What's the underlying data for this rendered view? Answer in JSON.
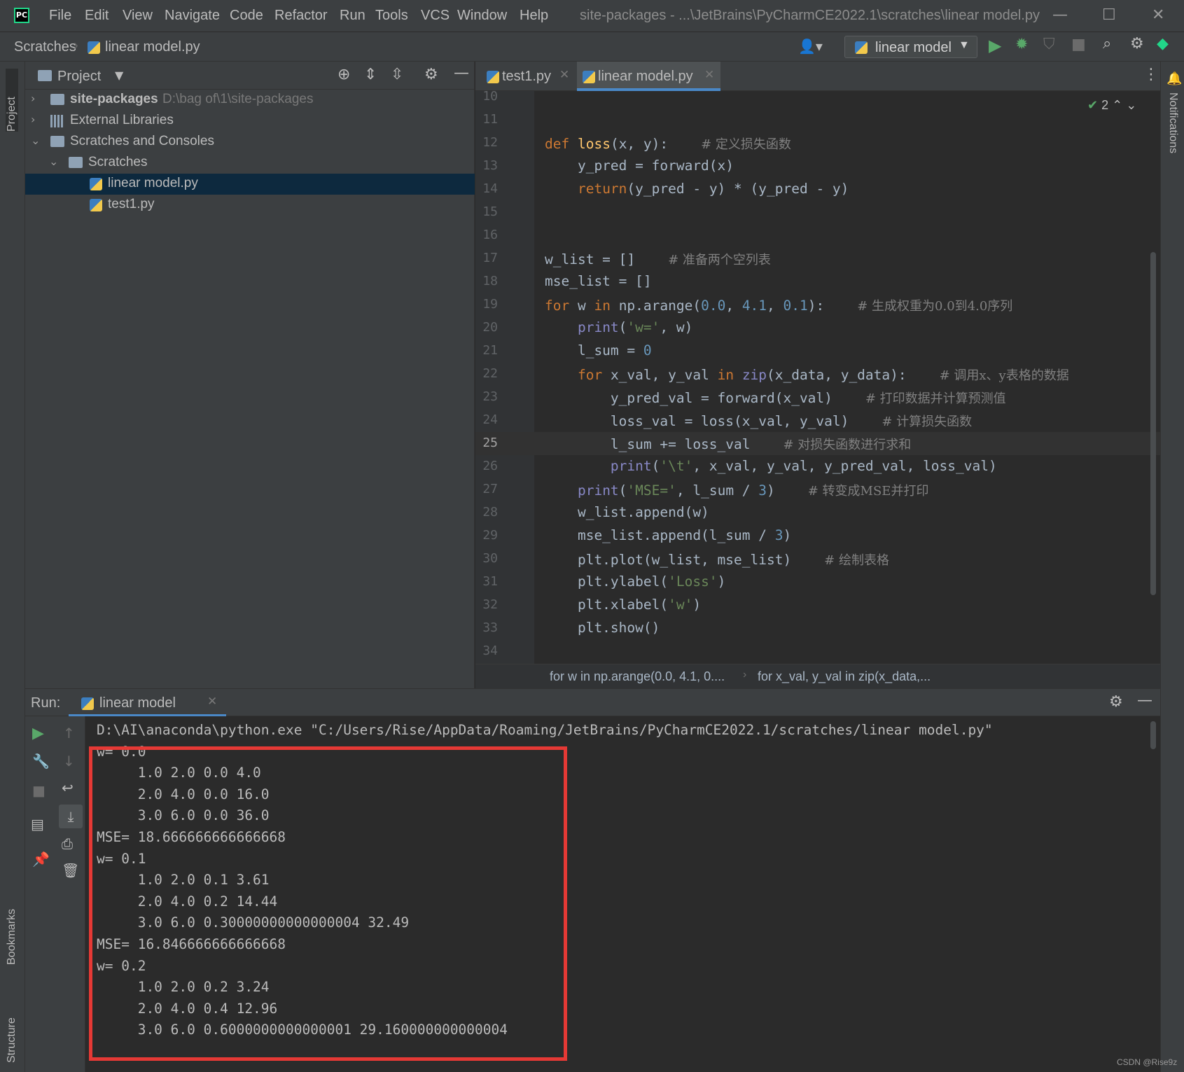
{
  "app": {
    "logo_text": "PC",
    "window_title": "site-packages - ...\\JetBrains\\PyCharmCE2022.1\\scratches\\linear model.py"
  },
  "menu": [
    "File",
    "Edit",
    "View",
    "Navigate",
    "Code",
    "Refactor",
    "Run",
    "Tools",
    "VCS",
    "Window",
    "Help"
  ],
  "breadcrumb": {
    "root": "Scratches",
    "file": "linear model.py"
  },
  "run_config": {
    "label": "linear model"
  },
  "sidebar_tabs": {
    "left_top": "Project",
    "left_bottom_1": "Bookmarks",
    "left_bottom_2": "Structure",
    "right": "Notifications"
  },
  "project": {
    "title": "Project",
    "tree": [
      {
        "label": "site-packages",
        "hint": "D:\\bag of\\1\\site-packages",
        "expanded": false
      },
      {
        "label": "External Libraries",
        "expanded": false
      },
      {
        "label": "Scratches and Consoles",
        "expanded": true
      },
      {
        "label": "Scratches",
        "expanded": true
      },
      {
        "label": "linear model.py",
        "selected": true
      },
      {
        "label": "test1.py"
      }
    ]
  },
  "editor": {
    "tabs": [
      {
        "label": "test1.py",
        "active": false
      },
      {
        "label": "linear model.py",
        "active": true
      }
    ],
    "inspection_count": "2",
    "current_line": 25,
    "lines": [
      {
        "n": "10",
        "code": ""
      },
      {
        "n": "11",
        "code": ""
      },
      {
        "n": "12",
        "code": "def loss(x, y):",
        "comment": "# 定义损失函数"
      },
      {
        "n": "13",
        "code": "    y_pred = forward(x)"
      },
      {
        "n": "14",
        "code": "    return(y_pred - y) * (y_pred - y)"
      },
      {
        "n": "15",
        "code": ""
      },
      {
        "n": "16",
        "code": ""
      },
      {
        "n": "17",
        "code": "w_list = []",
        "comment": "# 准备两个空列表"
      },
      {
        "n": "18",
        "code": "mse_list = []"
      },
      {
        "n": "19",
        "code": "for w in np.arange(0.0, 4.1, 0.1):",
        "comment": "# 生成权重为0.0到4.0序列"
      },
      {
        "n": "20",
        "code": "    print('w=', w)"
      },
      {
        "n": "21",
        "code": "    l_sum = 0"
      },
      {
        "n": "22",
        "code": "    for x_val, y_val in zip(x_data, y_data):",
        "comment": "# 调用x、y表格的数据"
      },
      {
        "n": "23",
        "code": "        y_pred_val = forward(x_val)",
        "comment": "# 打印数据并计算预测值"
      },
      {
        "n": "24",
        "code": "        loss_val = loss(x_val, y_val)",
        "comment": "# 计算损失函数"
      },
      {
        "n": "25",
        "code": "        l_sum += loss_val",
        "comment": "# 对损失函数进行求和"
      },
      {
        "n": "26",
        "code": "        print('\\t', x_val, y_val, y_pred_val, loss_val)"
      },
      {
        "n": "27",
        "code": "    print('MSE=', l_sum / 3)",
        "comment": "# 转变成MSE并打印"
      },
      {
        "n": "28",
        "code": "    w_list.append(w)"
      },
      {
        "n": "29",
        "code": "    mse_list.append(l_sum / 3)"
      },
      {
        "n": "30",
        "code": "    plt.plot(w_list, mse_list)",
        "comment": "# 绘制表格"
      },
      {
        "n": "31",
        "code": "    plt.ylabel('Loss')"
      },
      {
        "n": "32",
        "code": "    plt.xlabel('w')"
      },
      {
        "n": "33",
        "code": "    plt.show()"
      },
      {
        "n": "34",
        "code": ""
      }
    ],
    "breadcrumb": [
      "for w in np.arange(0.0, 4.1, 0....",
      "for x_val, y_val in zip(x_data,..."
    ]
  },
  "run": {
    "label": "Run:",
    "tab_label": "linear model",
    "console": [
      "D:\\AI\\anaconda\\python.exe \"C:/Users/Rise/AppData/Roaming/JetBrains/PyCharmCE2022.1/scratches/linear model.py\"",
      "w= 0.0",
      "\t 1.0 2.0 0.0 4.0",
      "\t 2.0 4.0 0.0 16.0",
      "\t 3.0 6.0 0.0 36.0",
      "MSE= 18.666666666666668",
      "w= 0.1",
      "\t 1.0 2.0 0.1 3.61",
      "\t 2.0 4.0 0.2 14.44",
      "\t 3.0 6.0 0.30000000000000004 32.49",
      "MSE= 16.846666666666668",
      "w= 0.2",
      "\t 1.0 2.0 0.2 3.24",
      "\t 2.0 4.0 0.4 12.96",
      "\t 3.0 6.0 0.6000000000000001 29.160000000000004"
    ]
  },
  "watermark": "CSDN @Rise9z",
  "colors": {
    "highlight_box": "#e53935",
    "accent": "#4a88c7",
    "run_green": "#59a869"
  }
}
